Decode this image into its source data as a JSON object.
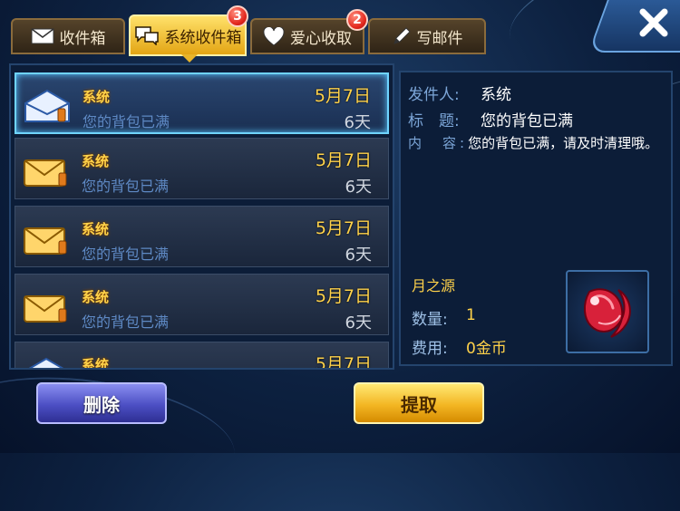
{
  "tabs": [
    {
      "label": "收件箱",
      "icon": "envelope-icon",
      "badge": null,
      "active": false
    },
    {
      "label": "系统收件箱",
      "icon": "speech-bubbles-icon",
      "badge": "3",
      "active": true
    },
    {
      "label": "爱心收取",
      "icon": "heart-icon",
      "badge": "2",
      "active": false
    },
    {
      "label": "写邮件",
      "icon": "pencil-icon",
      "badge": null,
      "active": false
    }
  ],
  "mail_list": [
    {
      "sender": "系统",
      "subject": "您的背包已满",
      "date": "5月7日",
      "expires": "6天",
      "selected": true
    },
    {
      "sender": "系统",
      "subject": "您的背包已满",
      "date": "5月7日",
      "expires": "6天",
      "selected": false
    },
    {
      "sender": "系统",
      "subject": "您的背包已满",
      "date": "5月7日",
      "expires": "6天",
      "selected": false
    },
    {
      "sender": "系统",
      "subject": "您的背包已满",
      "date": "5月7日",
      "expires": "6天",
      "selected": false
    },
    {
      "sender": "系统",
      "subject": "",
      "date": "5月7日",
      "expires": "",
      "selected": false
    }
  ],
  "detail": {
    "sender_label": "发件人:",
    "sender_value": "系统",
    "subject_label": "标　题:",
    "subject_value": "您的背包已满",
    "content_label": "内　容:",
    "content_value": "您的背包已满，请及时清理哦。",
    "attachment": {
      "name": "月之源",
      "quantity_label": "数量:",
      "quantity_value": "1",
      "fee_label": "费用:",
      "fee_value": "0金币",
      "icon": "moon-source-gem-icon"
    }
  },
  "buttons": {
    "delete": "删除",
    "collect": "提取"
  },
  "colors": {
    "gold": "#ffd24a",
    "label_blue": "#7ca6d8",
    "selected_border": "#6fd4ff",
    "badge_red": "#e2261c"
  }
}
